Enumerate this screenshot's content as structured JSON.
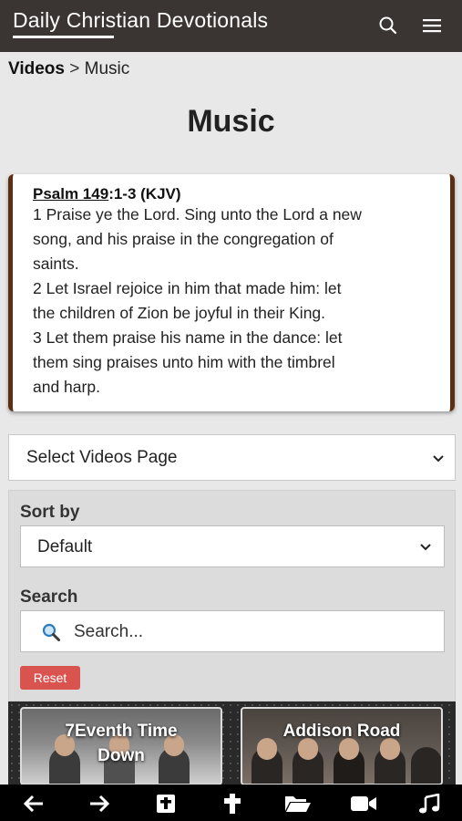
{
  "header": {
    "site_title": "Daily Christian Devotionals",
    "search_icon": "search-icon",
    "menu_icon": "hamburger-menu-icon"
  },
  "breadcrumb": {
    "parent": "Videos",
    "separator": ">",
    "current": "Music"
  },
  "page_title": "Music",
  "verse": {
    "book": "Psalm 149",
    "reference_rest": ":1-3 (KJV)",
    "lines": [
      "1 Praise ye the Lord. Sing unto the Lord a new",
      "song, and his praise in the congregation of",
      "saints.",
      "2 Let Israel rejoice in him that made him: let",
      "the children of Zion be joyful in their King.",
      "3 Let them praise his name in the dance: let",
      "them sing praises unto him with the timbrel",
      "and harp."
    ],
    "border_color": "#5c2f14"
  },
  "videos_page_select": {
    "value": "Select Videos Page"
  },
  "filters": {
    "sort_label": "Sort by",
    "sort_value": "Default",
    "search_label": "Search",
    "search_placeholder": "Search...",
    "reset_label": "Reset",
    "reset_color": "#d9534f"
  },
  "videos": [
    {
      "title_line1": "7Eventh Time",
      "title_line2": "Down"
    },
    {
      "title_line1": "Addison Road",
      "title_line2": ""
    }
  ],
  "bottom_nav": {
    "icons": [
      "back-arrow-icon",
      "forward-arrow-icon",
      "bible-icon",
      "cross-icon",
      "folder-icon",
      "video-camera-icon",
      "music-note-icon"
    ]
  }
}
